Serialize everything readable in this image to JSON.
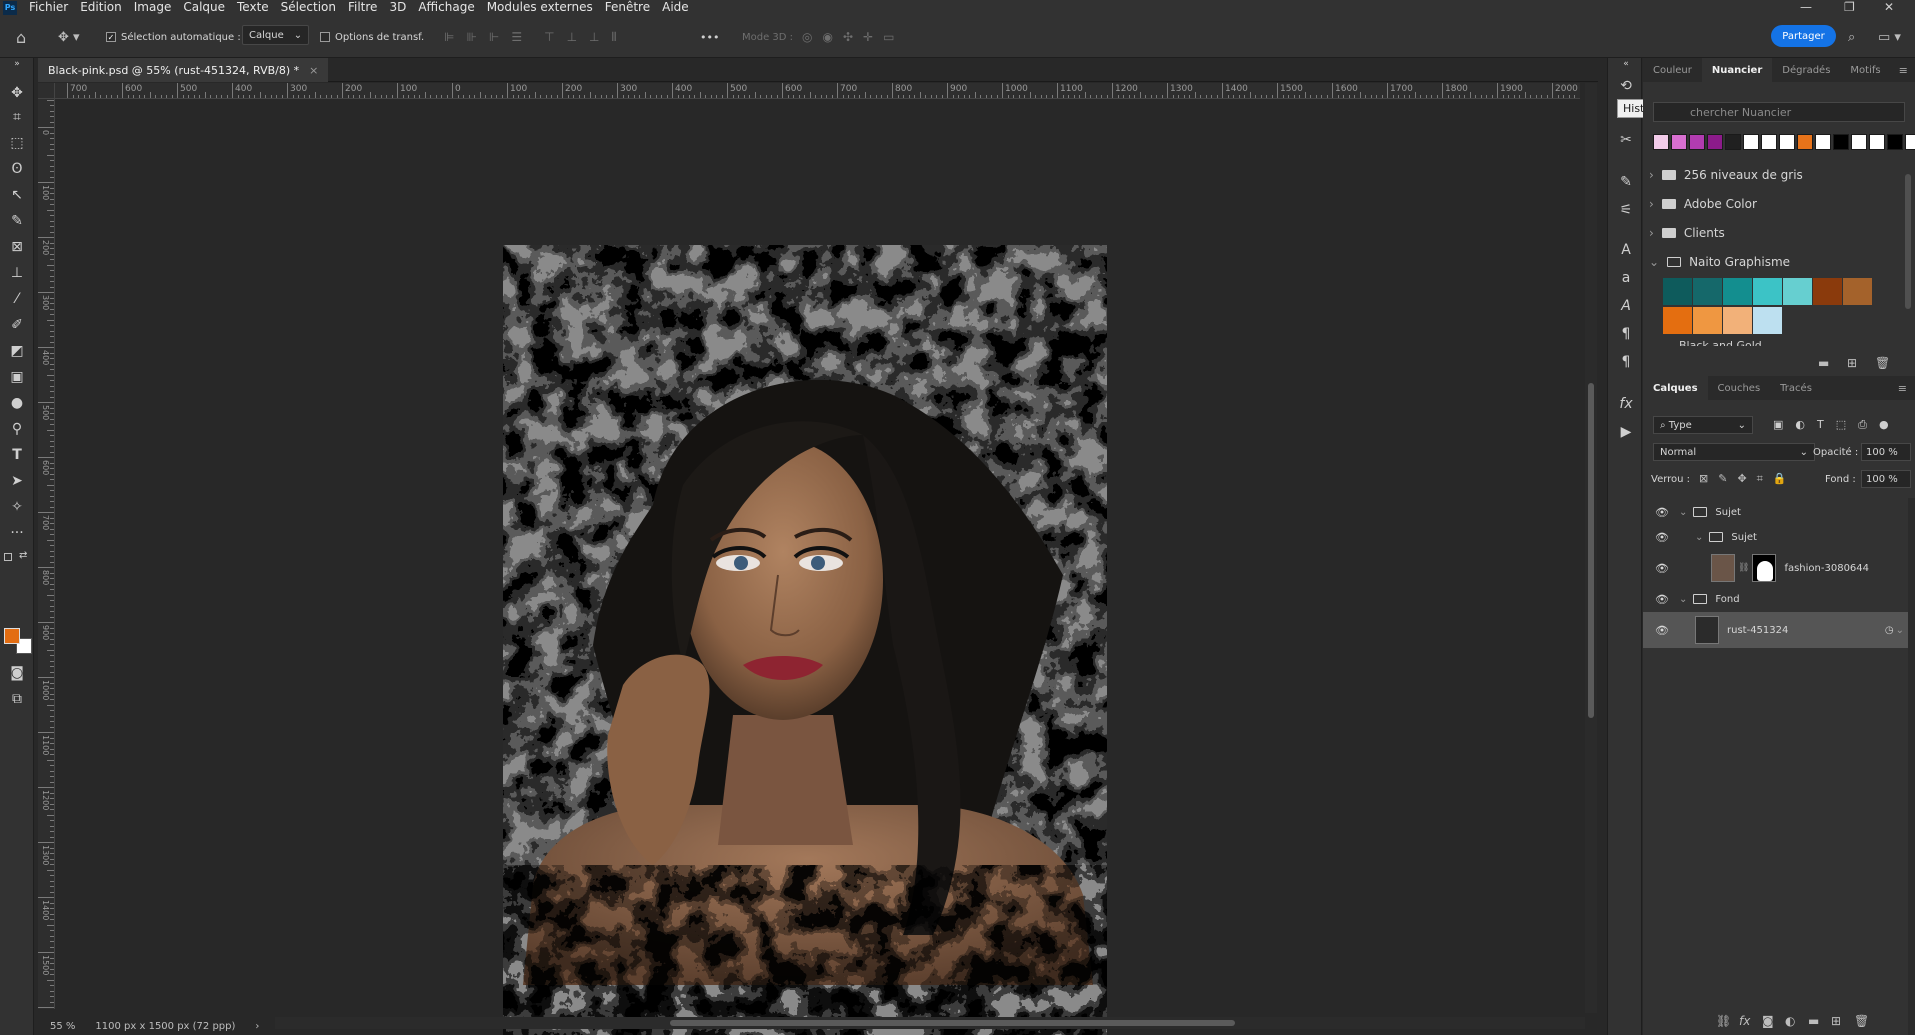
{
  "app": {
    "logo": "Ps"
  },
  "menu": [
    "Fichier",
    "Edition",
    "Image",
    "Calque",
    "Texte",
    "Sélection",
    "Filtre",
    "3D",
    "Affichage",
    "Modules externes",
    "Fenêtre",
    "Aide"
  ],
  "window_controls": [
    "—",
    "❐",
    "✕"
  ],
  "options": {
    "auto_select_label": "Sélection automatique :",
    "auto_select_checked": true,
    "auto_select_target": "Calque",
    "transform_options_label": "Options de transf.",
    "mode3d_label": "Mode 3D :",
    "more_label": "•••",
    "share_label": "Partager"
  },
  "document": {
    "tab_title": "Black-pink.psd @ 55% (rust-451324, RVB/8) *",
    "close_symbol": "×",
    "zoom": "55 %",
    "info": "1100 px x 1500 px (72 ppp)"
  },
  "ruler_h_labels": [
    "700",
    "600",
    "500",
    "400",
    "300",
    "200",
    "100",
    "0",
    "100",
    "200",
    "300",
    "400",
    "500",
    "600",
    "700",
    "800",
    "900",
    "1000",
    "1100",
    "1200",
    "1300",
    "1400",
    "1500",
    "1600",
    "1700",
    "1800",
    "1900",
    "2000"
  ],
  "ruler_v_labels": [
    "0",
    "0",
    "100",
    "200",
    "300",
    "400",
    "500",
    "600",
    "700",
    "800",
    "900",
    "1000",
    "1100",
    "1200",
    "1300",
    "1400",
    "1500",
    "1600"
  ],
  "tooltip": "Historique",
  "swatches_panel": {
    "tabs": [
      "Couleur",
      "Nuancier",
      "Dégradés",
      "Motifs"
    ],
    "active_tab": "Nuancier",
    "search_placeholder": "chercher Nuancier",
    "recent_colors": [
      "#f2cbe9",
      "#d86fd0",
      "#b23cb0",
      "#8c1b8a",
      "#202020",
      "#ffffff",
      "#ffffff",
      "#ffffff",
      "#e7731a",
      "#ffffff",
      "#000000",
      "#ffffff",
      "#ffffff",
      "#000000",
      "#ffffff"
    ],
    "groups": [
      {
        "name": "256 niveaux de gris",
        "expanded": false
      },
      {
        "name": "Adobe Color",
        "expanded": false
      },
      {
        "name": "Clients",
        "expanded": false
      },
      {
        "name": "Naito Graphisme",
        "expanded": true
      }
    ],
    "naito_colors": [
      "#0e5b5c",
      "#15686a",
      "#138e8f",
      "#3cc3c6",
      "#66cfd0",
      "#8a3a0c",
      "#a4622b",
      "#e46e10",
      "#ef9741",
      "#f2b179",
      "#bde0f0"
    ],
    "next_group_partial": "Black and Gold"
  },
  "layers_panel": {
    "tabs": [
      "Calques",
      "Couches",
      "Tracés"
    ],
    "active_tab": "Calques",
    "filter_label": "Type",
    "blend_mode": "Normal",
    "opacity_label": "Opacité :",
    "opacity_value": "100 %",
    "lock_label": "Verrou :",
    "fill_label": "Fond :",
    "fill_value": "100 %",
    "layers": [
      {
        "name": "Sujet",
        "type": "group",
        "indent": 0
      },
      {
        "name": "Sujet",
        "type": "group",
        "indent": 1
      },
      {
        "name": "fashion-3080644",
        "type": "layer-with-mask",
        "indent": 2
      },
      {
        "name": "Fond",
        "type": "group",
        "indent": 0
      },
      {
        "name": "rust-451324",
        "type": "layer",
        "indent": 1,
        "selected": true
      }
    ]
  },
  "colors": {
    "foreground": "#e36d12",
    "background": "#ffffff",
    "accent": "#1473e6"
  }
}
